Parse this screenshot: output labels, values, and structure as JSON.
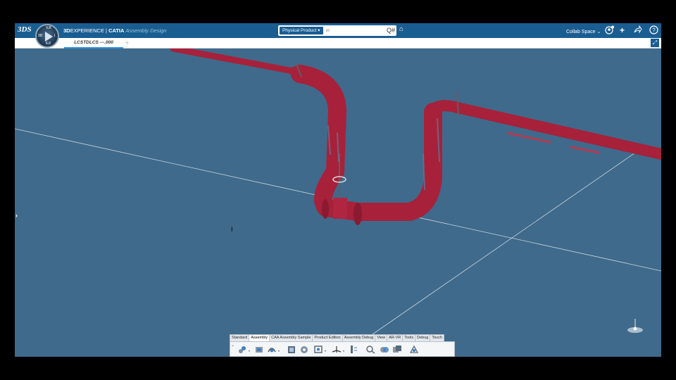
{
  "topbar": {
    "logo_text": "3DS",
    "brand_bold": "3D",
    "brand_rest": "EXPERIENCE | ",
    "brand_product": "CATIA",
    "brand_app": "Assembly Design",
    "compass": {
      "n": "V.R",
      "w": "3D",
      "e": "i",
      "s": "6.0"
    },
    "search_tag": "Physical Product",
    "search_placeholder": "in",
    "search_icon": "Q#",
    "collab_label": "Collab Space",
    "icons": [
      "user-icon",
      "plus-icon",
      "share-icon",
      "help-icon"
    ]
  },
  "tabs": {
    "active_label": "LCSTDLCS ---.000",
    "add_label": "+"
  },
  "viewport": {
    "background_color": "#3f6a8b",
    "pipe_color": "#a7213a"
  },
  "actionbar": {
    "tabs": [
      "Standard",
      "Assembly",
      "CAA Assembly Sample",
      "Product Edition",
      "Assembly Debug",
      "View",
      "AR-VR",
      "Tools",
      "Debug",
      "Touch"
    ],
    "active_tab": "Assembly"
  }
}
